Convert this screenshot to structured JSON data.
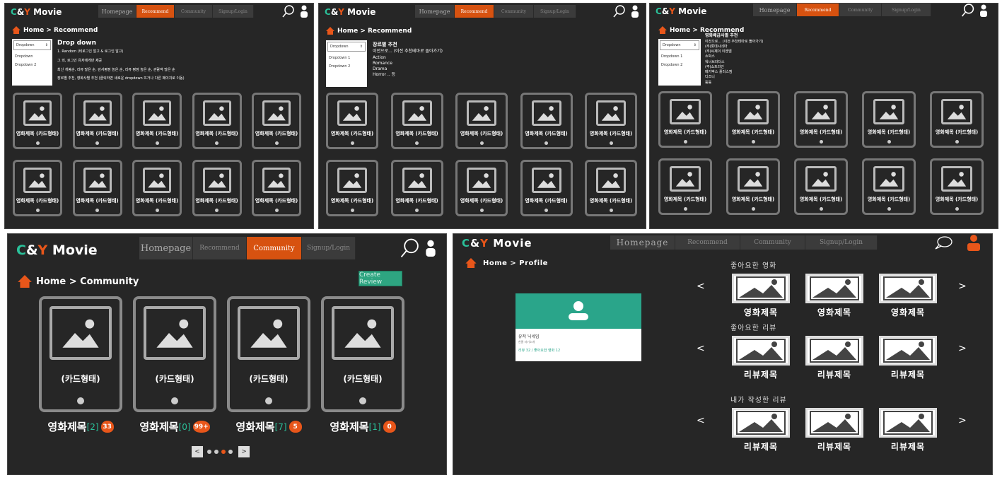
{
  "brand": {
    "c": "C",
    "amp": "&",
    "y": "Y",
    "rest": " Movie"
  },
  "nav": {
    "home": "Homepage",
    "recommend": "Recommend",
    "community": "Community",
    "signup": "Signup/Login"
  },
  "p1": {
    "crumb": "Home > Recommend",
    "dropdown": {
      "selected": "Dropdown",
      "options": [
        "Dropdown",
        "Dropdown 2"
      ]
    },
    "info": {
      "heading": "Drop down",
      "lines": [
        "1. Random (비로그인 알고 & 로그인 알고)",
        "그 외, 로그인 유저에게만 제공",
        "최신 개봉순, 리뷰 많은 순, 감서평점 높은 순, 리뷰 평점 높은 순, 관람객 많은 순",
        "장르별 추천, 영화사별 추천 (클릭하면 새로운 dropdown 뜨거나 다른 페이지로 이동)"
      ]
    },
    "cards_row1": [
      "영화제목 (카드형태)",
      "영화제목 (카드형태)",
      "영화제목 (카드형태)",
      "영화제목 (카드형태)",
      "영화제목 (카드형태)"
    ],
    "cards_row2": [
      "영화제목 (카드형태)",
      "영화제목 (카드형태)",
      "영화제목 (카드형태)",
      "영화제목 (카드형태)",
      "영화제목 (카드형태)"
    ]
  },
  "p2": {
    "crumb": "Home > Recommend",
    "dropdown": {
      "selected": "Dropdown",
      "options": [
        "Dropdown 1",
        "Dropdown 2"
      ]
    },
    "info": {
      "heading": "장르별 추천",
      "lines": [
        "이전으로... (이전 추천테마로 돌아가기)",
        "Action",
        "Romance",
        "Drama",
        "Horror .. 등"
      ]
    },
    "cards_row1": [
      "영화제목 (카드형태)",
      "영화제목 (카드형태)",
      "영화제목 (카드형태)",
      "영화제목 (카드형태)",
      "영화제목 (카드형태)"
    ],
    "cards_row2": [
      "영화제목 (카드형태)",
      "영화제목 (카드형태)",
      "영화제목 (카드형태)",
      "영화제목 (카드형태)",
      "영화제목 (카드형태)"
    ]
  },
  "p3": {
    "crumb": "Home > Recommend",
    "dropdown": {
      "selected": "Dropdown",
      "options": [
        "Dropdown 1",
        "Dropdown 2"
      ]
    },
    "info": {
      "heading": "영화배급사별 추천",
      "lines": [
        "이전으로... (이전 추천테마로 돌아가기)",
        "(주)롯데시네마",
        "(주)씨제이 이엔엠",
        "쇼박스",
        "워너브라더스",
        "(주)쇼트라인",
        "메가박스 플러스엠",
        "디즈니",
        "등등"
      ]
    },
    "cards_row1": [
      "영화제목 (카드형태)",
      "영화제목 (카드형태)",
      "영화제목 (카드형태)",
      "영화제목 (카드형태)",
      "영화제목 (카드형태)"
    ],
    "cards_row2": [
      "영화제목 (카드형태)",
      "영화제목 (카드형태)",
      "영화제목 (카드형태)",
      "영화제목 (카드형태)",
      "영화제목 (카드형태)"
    ]
  },
  "p4": {
    "crumb": "Home > Community",
    "create_review": "Create Review",
    "cards": [
      {
        "card_label": "(카드형태)",
        "title": "영화제목",
        "count": "[2]",
        "likes": "33"
      },
      {
        "card_label": "(카드형태)",
        "title": "영화제목",
        "count": "[0]",
        "likes": "99+"
      },
      {
        "card_label": "(카드형태)",
        "title": "영화제목",
        "count": "[7]",
        "likes": "5"
      },
      {
        "card_label": "(카드형태)",
        "title": "영화제목",
        "count": "[1]",
        "likes": "0"
      }
    ],
    "pager": {
      "prev": "<",
      "next": ">",
      "active_page": 3,
      "pages": 4
    }
  },
  "p5": {
    "crumb": "Home > Profile",
    "profile": {
      "name": "유저 닉네임",
      "sub": "한줄 자기소개",
      "stats": "리뷰 32 / 좋아요한 영화 12"
    },
    "sections": [
      {
        "title": "좋아요한 영화",
        "items": [
          "영화제목",
          "영화제목",
          "영화제목"
        ]
      },
      {
        "title": "좋아요한 리뷰",
        "items": [
          "리뷰제목",
          "리뷰제목",
          "리뷰제목"
        ]
      },
      {
        "title": "내가 작성한 리뷰",
        "items": [
          "리뷰제목",
          "리뷰제목",
          "리뷰제목"
        ]
      }
    ],
    "arrows": {
      "left": "<",
      "right": ">"
    }
  },
  "colors": {
    "bg": "#262626",
    "accent": "#d75210",
    "brand_green": "#2ac19a",
    "brand_orange": "#e8561a",
    "button_green": "#2ea581"
  }
}
